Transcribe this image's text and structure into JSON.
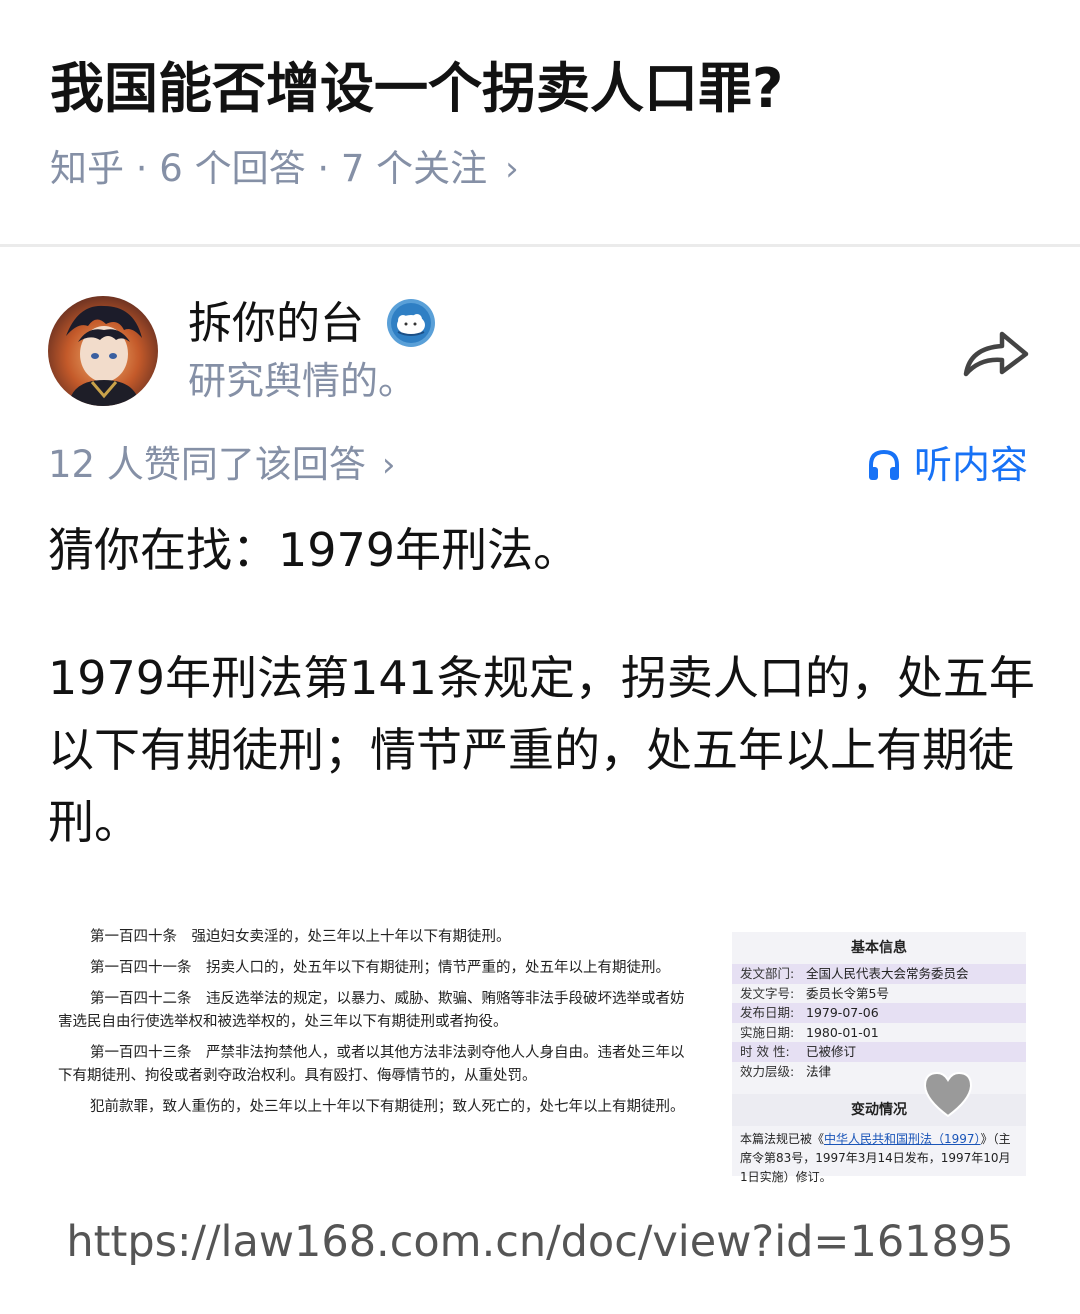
{
  "question": {
    "title": "我国能否增设一个拐卖人口罪?",
    "meta": "知乎 · 6 个回答 · 7 个关注",
    "meta_chevron": "›"
  },
  "author": {
    "name": "拆你的台",
    "bio": "研究舆情的。",
    "avatar_icon": "anime-avatar",
    "badge_icon": "sheep-badge-icon"
  },
  "actions": {
    "share_icon": "share-arrow-icon",
    "votes": "12 人赞同了该回答",
    "votes_chevron": "›",
    "listen": "听内容",
    "listen_icon": "headphones-icon",
    "accent": "#1772f6"
  },
  "answer": {
    "paragraph1": "猜你在找：1979年刑法。",
    "paragraph2": "1979年刑法第141条规定，拐卖人口的，处五年以下有期徒刑；情节严重的，处五年以上有期徒刑。"
  },
  "screenshot": {
    "articles": [
      "第一百四十条　强迫妇女卖淫的，处三年以上十年以下有期徒刑。",
      "第一百四十一条　拐卖人口的，处五年以下有期徒刑；情节严重的，处五年以上有期徒刑。",
      "第一百四十二条　违反选举法的规定，以暴力、威胁、欺骗、贿赂等非法手段破坏选举或者妨害选民自由行使选举权和被选举权的，处三年以下有期徒刑或者拘役。",
      "第一百四十三条　严禁非法拘禁他人，或者以其他方法非法剥夺他人人身自由。违者处三年以下有期徒刑、拘役或者剥夺政治权利。具有殴打、侮辱情节的，从重处罚。",
      "犯前款罪，致人重伤的，处三年以上十年以下有期徒刑；致人死亡的，处七年以上有期徒刑。"
    ],
    "info": {
      "heading": "基本信息",
      "rows": [
        {
          "k": "发文部门:",
          "v": "全国人民代表大会常务委员会"
        },
        {
          "k": "发文字号:",
          "v": "委员长令第5号"
        },
        {
          "k": "发布日期:",
          "v": "1979-07-06"
        },
        {
          "k": "实施日期:",
          "v": "1980-01-01"
        },
        {
          "k": "时 效 性:",
          "v": "已被修订"
        },
        {
          "k": "效力层级:",
          "v": "法律"
        }
      ],
      "heading2": "变动情况",
      "change_prefix": "本篇法规已被《",
      "change_link": "中华人民共和国刑法（1997）",
      "change_suffix": "》（主席令第83号，1997年3月14日发布，1997年10月1日实施）修订。"
    }
  },
  "source_url": "https://law168.com.cn/doc/view?id=161895"
}
